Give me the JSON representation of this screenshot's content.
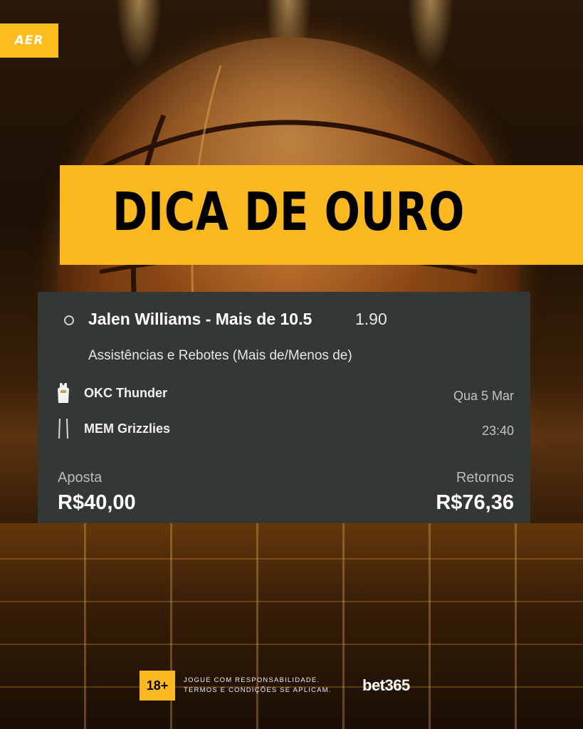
{
  "brand_logo": {
    "text": "AER"
  },
  "banner": {
    "title": "DICA DE OURO"
  },
  "bet_slip": {
    "selection": "Jalen Williams - Mais de 10.5",
    "odds": "1.90",
    "market": "Assistências e Rebotes (Mais de/Menos de)",
    "home_team": "OKC Thunder",
    "away_team": "MEM Grizzlies",
    "date": "Qua 5 Mar",
    "time": "23:40",
    "stake_label": "Aposta",
    "stake_value": "R$40,00",
    "returns_label": "Retornos",
    "returns_value": "R$76,36"
  },
  "footer": {
    "age_badge": "18+",
    "disclaimer_line1": "JOGUE COM RESPONSABILIDADE.",
    "disclaimer_line2": "TERMOS E CONDIÇÕES SE APLICAM.",
    "sponsor": "bet365"
  },
  "colors": {
    "accent": "#fcb91f",
    "card": "#333837"
  }
}
